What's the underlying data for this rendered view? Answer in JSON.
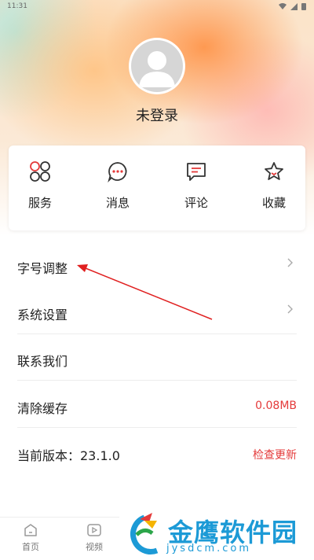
{
  "status_bar": {
    "time": "11:31"
  },
  "profile": {
    "username": "未登录"
  },
  "quick_actions": [
    {
      "label": "服务",
      "icon": "four-circles-icon"
    },
    {
      "label": "消息",
      "icon": "chat-bubble-icon"
    },
    {
      "label": "评论",
      "icon": "comment-icon"
    },
    {
      "label": "收藏",
      "icon": "star-icon"
    }
  ],
  "settings": [
    {
      "label": "字号调整",
      "right": "",
      "chevron": true
    },
    {
      "label": "系统设置",
      "right": "",
      "chevron": true
    },
    {
      "label": "联系我们",
      "right": "",
      "chevron": false
    },
    {
      "label": "清除缓存",
      "right": "0.08MB",
      "chevron": false
    },
    {
      "label": "当前版本：23.1.0",
      "right": "检查更新",
      "chevron": false
    }
  ],
  "tabbar": [
    {
      "label": "首页",
      "icon": "home-icon"
    },
    {
      "label": "视频",
      "icon": "video-icon"
    }
  ],
  "watermark": {
    "title": "金鹰软件园",
    "subtitle": "jysdcm.com"
  },
  "colors": {
    "accent": "#e43a3a",
    "icon_dark": "#333333",
    "watermark": "#1c9ad6"
  }
}
